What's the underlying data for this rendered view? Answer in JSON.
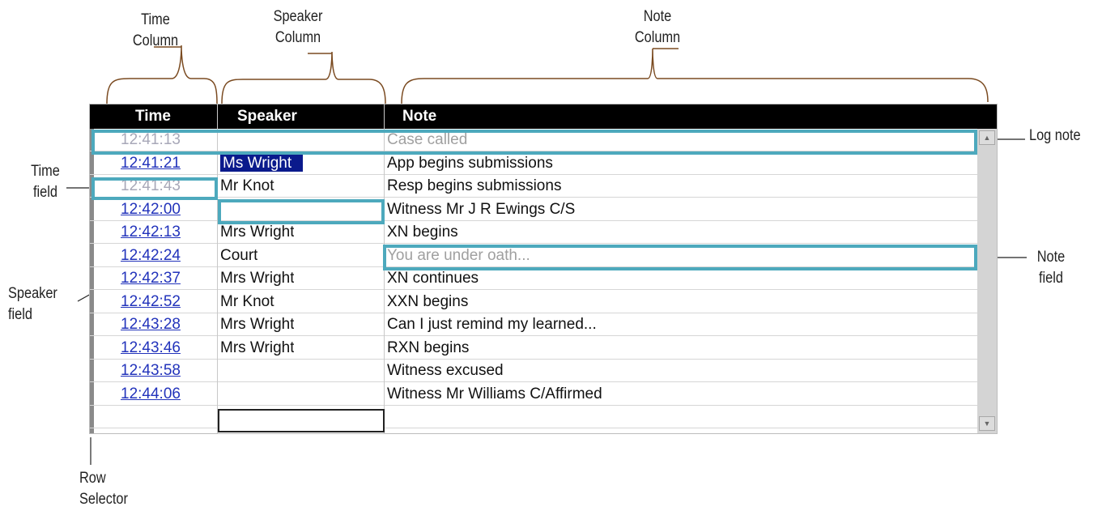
{
  "callouts": {
    "time_column": "Time\nColumn",
    "speaker_column": "Speaker\nColumn",
    "note_column": "Note\nColumn",
    "log_note": "Log note",
    "time_field": "Time\nfield",
    "note_field": "Note\nfield",
    "speaker_field": "Speaker\nfield",
    "row_selector": "Row\nSelector"
  },
  "columns": {
    "time": "Time",
    "speaker": "Speaker",
    "note": "Note"
  },
  "rows": [
    {
      "time": "12:41:13",
      "speaker": "",
      "note": "Case called"
    },
    {
      "time": "12:41:21",
      "speaker": "Ms Wright",
      "note": "App begins submissions"
    },
    {
      "time": "12:41:43",
      "speaker": "Mr Knot",
      "note": "Resp begins submissions"
    },
    {
      "time": "12:42:00",
      "speaker": "",
      "note": "Witness Mr J R Ewings C/S"
    },
    {
      "time": "12:42:13",
      "speaker": "Mrs Wright",
      "note": "XN begins"
    },
    {
      "time": "12:42:24",
      "speaker": "Court",
      "note": "You are under oath..."
    },
    {
      "time": "12:42:37",
      "speaker": "Mrs Wright",
      "note": "XN continues"
    },
    {
      "time": "12:42:52",
      "speaker": "Mr Knot",
      "note": "XXN begins"
    },
    {
      "time": "12:43:28",
      "speaker": "Mrs Wright",
      "note": "Can I just remind my learned..."
    },
    {
      "time": "12:43:46",
      "speaker": "Mrs Wright",
      "note": "RXN begins"
    },
    {
      "time": "12:43:58",
      "speaker": "",
      "note": "Witness excused"
    },
    {
      "time": "12:44:06",
      "speaker": "",
      "note": "Witness Mr Williams C/Affirmed"
    }
  ],
  "colors": {
    "highlight": "#4da9bd",
    "selection": "#0a1a8c",
    "time_link": "#2233bb"
  }
}
